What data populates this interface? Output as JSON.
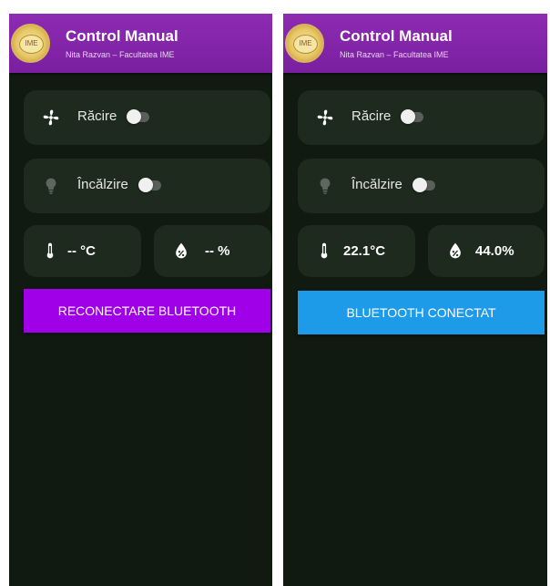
{
  "screens": [
    {
      "appbar": {
        "title": "Control Manual",
        "subtitle": "Nita Razvan – Facultatea IME",
        "logo_text": "IME"
      },
      "cooling": {
        "label": "Răcire",
        "icon": "fan-icon",
        "on": false
      },
      "heating": {
        "label": "Încălzire",
        "icon": "lightbulb-icon",
        "on": false
      },
      "temperature": {
        "value": "-- °C",
        "icon": "thermometer-icon"
      },
      "humidity": {
        "value": "-- %",
        "icon": "humidity-drop-icon"
      },
      "bluetooth_button": {
        "label": "RECONECTARE BLUETOOTH",
        "color": "#a000e8"
      }
    },
    {
      "appbar": {
        "title": "Control Manual",
        "subtitle": "Nita Razvan – Facultatea IME",
        "logo_text": "IME"
      },
      "cooling": {
        "label": "Răcire",
        "icon": "fan-icon",
        "on": false
      },
      "heating": {
        "label": "Încălzire",
        "icon": "lightbulb-icon",
        "on": false
      },
      "temperature": {
        "value": "22.1°C",
        "icon": "thermometer-icon"
      },
      "humidity": {
        "value": "44.0%",
        "icon": "humidity-drop-icon"
      },
      "bluetooth_button": {
        "label": "BLUETOOTH CONECTAT",
        "color": "#1e9be8"
      }
    }
  ],
  "theme": {
    "appbar_color": "#7b1fa2",
    "background": "#111a11",
    "card": "#1e2a1e",
    "text": "#ffffff"
  }
}
